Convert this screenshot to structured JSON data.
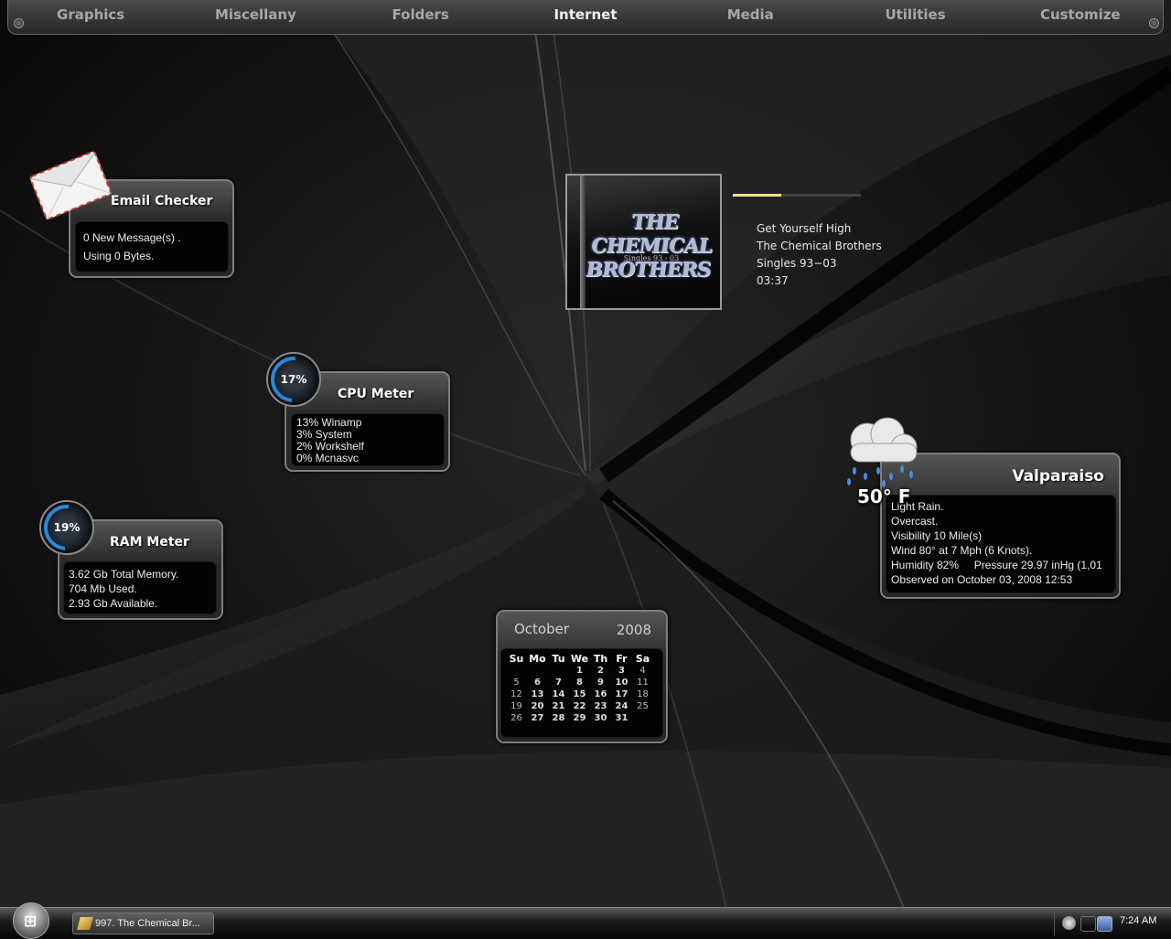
{
  "top_nav": {
    "items": [
      "Graphics",
      "Miscellany",
      "Folders",
      "Internet",
      "Media",
      "Utilities",
      "Customize"
    ],
    "active": "Internet"
  },
  "email_checker": {
    "title": "Email Checker",
    "icon": "envelope-icon",
    "lines": [
      "0 New Message(s) .",
      "Using 0 Bytes."
    ]
  },
  "cpu_meter": {
    "title": "CPU Meter",
    "gauge": "17%",
    "usage_fraction": 0.17,
    "lines": [
      "13% Winamp",
      "3% System",
      "2% Workshelf",
      "0% Mcnasvc"
    ]
  },
  "ram_meter": {
    "title": "RAM Meter",
    "gauge": "19%",
    "usage_fraction": 0.19,
    "lines": [
      "3.62 Gb Total Memory.",
      "704 Mb Used.",
      "2.93 Gb Available."
    ]
  },
  "now_playing": {
    "album_art_title": "THE CHEMICAL BROTHERS",
    "album_art_subtitle": "Singles 93 - 03",
    "track": "Get Yourself High",
    "artist": "The Chemical Brothers",
    "album": "Singles 93−03",
    "duration": "03:37",
    "progress_fraction": 0.38,
    "progress_color": "#f1e28a"
  },
  "weather": {
    "city": "Valparaiso",
    "temperature": "50° F",
    "icon": "rain-cloud-icon",
    "lines": [
      "Light Rain.",
      "Overcast.",
      "Visibility 10 Mile(s)",
      "Wind 80° at 7 Mph (6 Knots).",
      "Humidity 82%     Pressure 29.97 inHg (1,01",
      "Observed on October 03, 2008 12:53"
    ]
  },
  "calendar": {
    "month": "October",
    "year": "2008",
    "weekdays": [
      "Su",
      "Mo",
      "Tu",
      "We",
      "Th",
      "Fr",
      "Sa"
    ],
    "weeks": [
      [
        "",
        "",
        "",
        "1",
        "2",
        "3",
        "4"
      ],
      [
        "5",
        "6",
        "7",
        "8",
        "9",
        "10",
        "11"
      ],
      [
        "12",
        "13",
        "14",
        "15",
        "16",
        "17",
        "18"
      ],
      [
        "19",
        "20",
        "21",
        "22",
        "23",
        "24",
        "25"
      ],
      [
        "26",
        "27",
        "28",
        "29",
        "30",
        "31",
        ""
      ]
    ]
  },
  "taskbar": {
    "start_icon": "windows-logo-icon",
    "window_button": "997. The Chemical Br...",
    "clock": "7:24 AM",
    "tray_icons": [
      "speaker-icon",
      "media-icon",
      "network-icon"
    ]
  }
}
